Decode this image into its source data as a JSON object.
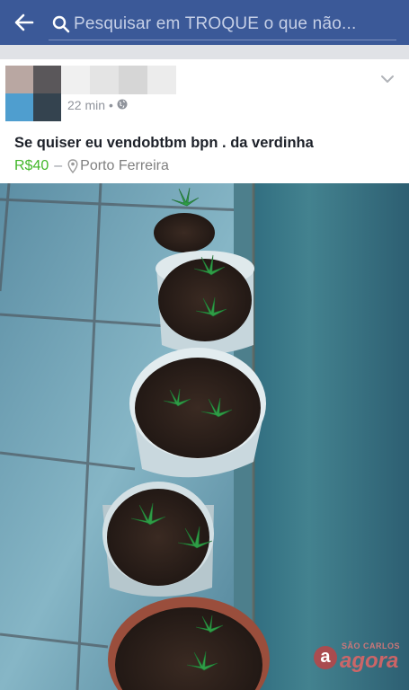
{
  "header": {
    "search_placeholder": "Pesquisar em TROQUE  o que não..."
  },
  "post": {
    "time": "22 min",
    "privacy_icon": "globe-icon",
    "text": "Se quiser eu vendobtbm bpn .  da verdinha",
    "price": "R$40",
    "separator": "–",
    "location": "Porto Ferreira"
  },
  "watermark": {
    "mark": "a",
    "city": "SÃO CARLOS",
    "name": "agora"
  },
  "colors": {
    "header_bg": "#3b5998",
    "price": "#42b72a",
    "meta_text": "#90949c"
  }
}
